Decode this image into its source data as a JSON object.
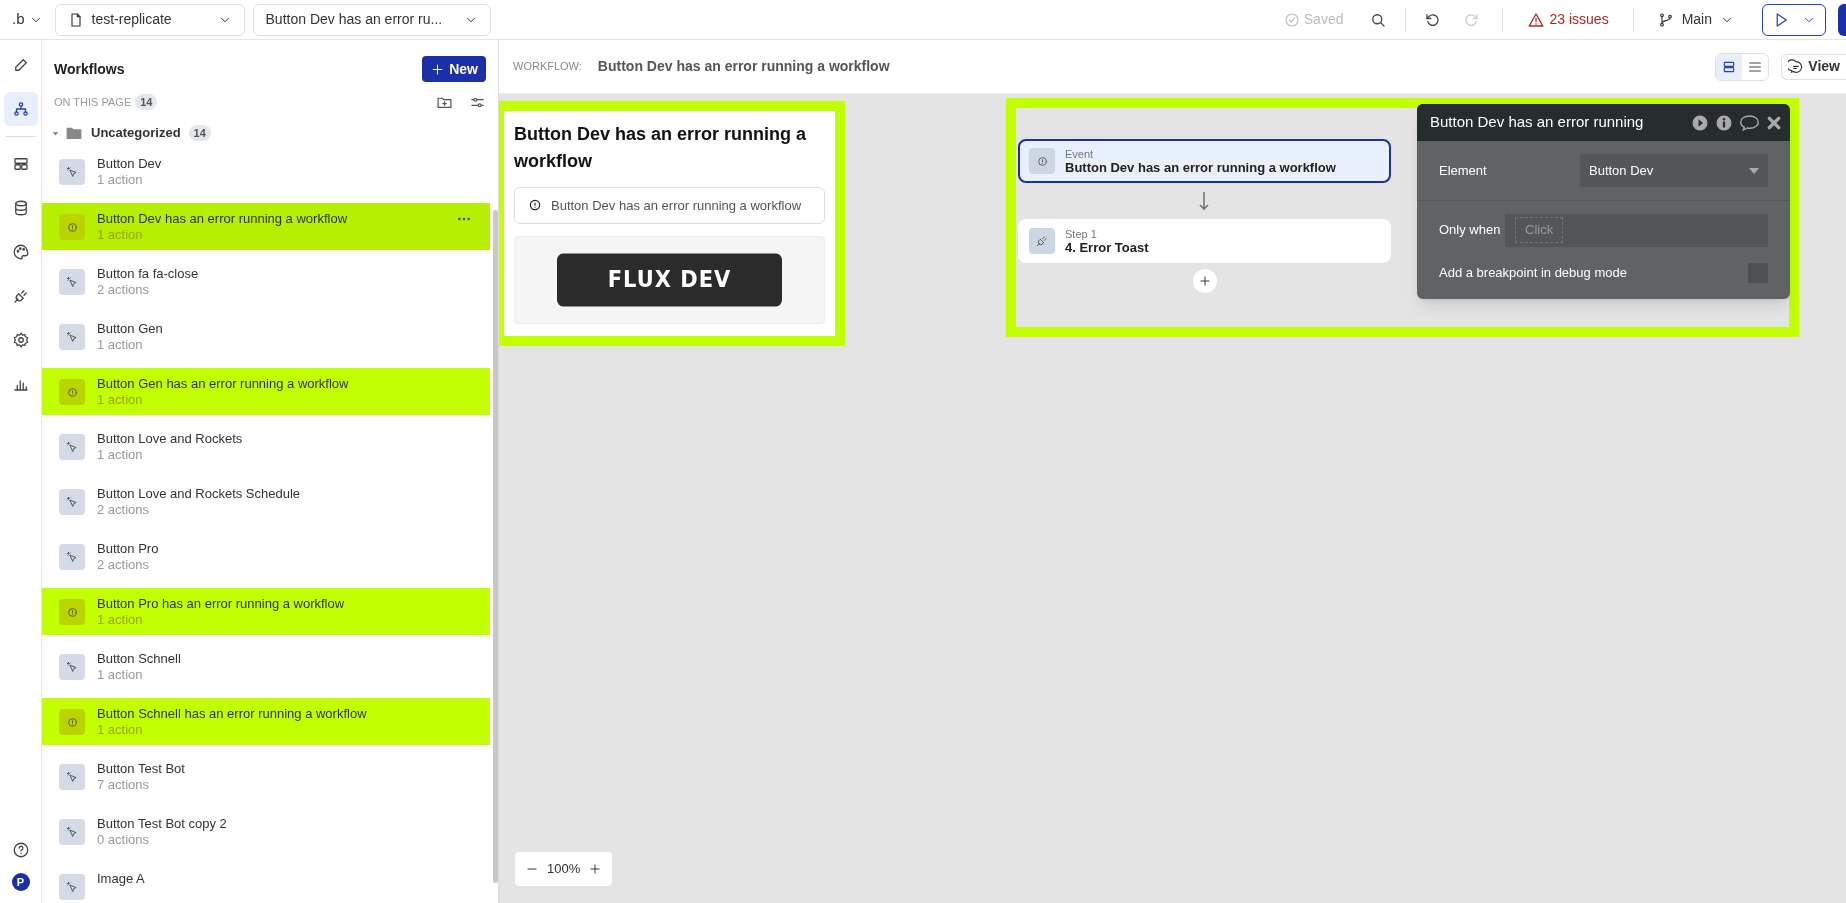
{
  "topbar": {
    "logo": ".b",
    "page_select": "test-replicate",
    "workflow_select": "Button Dev has an error ru...",
    "saved": "Saved",
    "issues": "23 issues",
    "branch": "Main"
  },
  "rail": {
    "items": [
      {
        "kind": "pencil",
        "selected": false
      },
      {
        "kind": "workflow",
        "selected": true
      },
      {
        "kind": "layout",
        "selected": false
      },
      {
        "kind": "database",
        "selected": false
      },
      {
        "kind": "palette",
        "selected": false
      },
      {
        "kind": "plug",
        "selected": false
      },
      {
        "kind": "gear",
        "selected": false
      },
      {
        "kind": "chart",
        "selected": false
      }
    ],
    "avatar": "P"
  },
  "sidebar": {
    "title": "Workflows",
    "new_button": "New",
    "section_label": "ON THIS PAGE",
    "section_count": "14",
    "folder": {
      "name": "Uncategorized",
      "count": "14",
      "expanded": true
    },
    "items": [
      {
        "name": "Button Dev",
        "actions": "1 action",
        "kind": "click",
        "selected": false
      },
      {
        "name": "Button Dev has an error running a workflow",
        "actions": "1 action",
        "kind": "error",
        "selected": true
      },
      {
        "name": "Button fa fa-close",
        "actions": "2 actions",
        "kind": "click",
        "selected": false
      },
      {
        "name": "Button Gen",
        "actions": "1 action",
        "kind": "click",
        "selected": false
      },
      {
        "name": "Button Gen has an error running a workflow",
        "actions": "1 action",
        "kind": "error",
        "selected": false
      },
      {
        "name": "Button Love and Rockets",
        "actions": "1 action",
        "kind": "click",
        "selected": false
      },
      {
        "name": "Button Love and Rockets Schedule",
        "actions": "2 actions",
        "kind": "click",
        "selected": false
      },
      {
        "name": "Button Pro",
        "actions": "2 actions",
        "kind": "click",
        "selected": false
      },
      {
        "name": "Button Pro has an error running a workflow",
        "actions": "1 action",
        "kind": "error",
        "selected": false
      },
      {
        "name": "Button Schnell",
        "actions": "1 action",
        "kind": "click",
        "selected": false
      },
      {
        "name": "Button Schnell has an error running a workflow",
        "actions": "1 action",
        "kind": "error",
        "selected": false
      },
      {
        "name": "Button Test Bot",
        "actions": "7 actions",
        "kind": "click",
        "selected": false
      },
      {
        "name": "Button Test Bot copy 2",
        "actions": "0 actions",
        "kind": "click",
        "selected": false
      },
      {
        "name": "Image A",
        "kind": "click",
        "selected": false
      }
    ]
  },
  "header": {
    "label": "WORKFLOW:",
    "title": "Button Dev has an error running a workflow",
    "views": [
      {
        "kind": "cards",
        "selected": true
      },
      {
        "kind": "list",
        "selected": false
      }
    ],
    "view_button": "View"
  },
  "canvas": {
    "preview": {
      "title": "Button Dev has an error running a workflow",
      "alert": "Button Dev has an error running a workflow",
      "button": "FLUX DEV"
    },
    "event": {
      "label": "Event",
      "title": "Button Dev has an error running a workflow",
      "selected": true
    },
    "step": {
      "label": "Step 1",
      "title": "4. Error Toast",
      "selected": false
    },
    "zoom": "100%"
  },
  "properties": {
    "title": "Button Dev has an error running",
    "element_label": "Element",
    "element_value": "Button Dev",
    "only_when_label": "Only when",
    "only_when_placeholder": "Click",
    "breakpoint_label": "Add a breakpoint in debug mode",
    "breakpoint_checked": false
  }
}
